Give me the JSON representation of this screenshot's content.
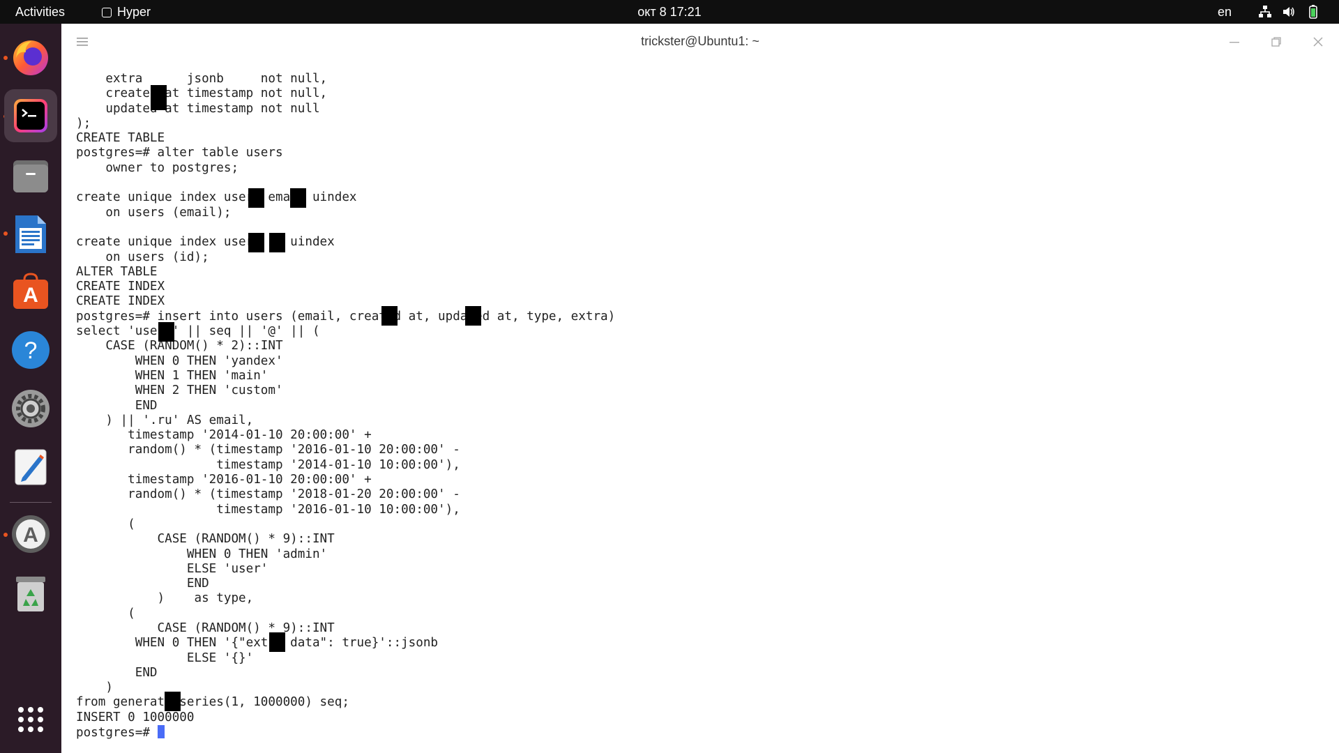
{
  "topbar": {
    "activities": "Activities",
    "app_name": "Hyper",
    "clock": "окт 8  17:21",
    "language": "en"
  },
  "dock": {
    "items": [
      {
        "name": "firefox",
        "icon": "firefox-icon"
      },
      {
        "name": "hyper-terminal",
        "icon": "terminal-icon",
        "active": true
      },
      {
        "name": "files",
        "icon": "files-icon"
      },
      {
        "name": "libreoffice-writer",
        "icon": "writer-icon"
      },
      {
        "name": "ubuntu-software",
        "icon": "software-icon"
      },
      {
        "name": "help",
        "icon": "help-icon"
      },
      {
        "name": "settings",
        "icon": "settings-icon"
      },
      {
        "name": "text-editor",
        "icon": "text-editor-icon"
      },
      {
        "name": "software-updater",
        "icon": "updater-icon"
      },
      {
        "name": "trash",
        "icon": "trash-icon"
      },
      {
        "name": "show-applications",
        "icon": "apps-grid-icon"
      }
    ]
  },
  "window": {
    "title": "trickster@Ubuntu1: ~"
  },
  "terminal": {
    "lines": [
      "    extra      jsonb     not null,",
      "    created at timestamp not null,",
      "    updated at timestamp not null",
      ");",
      "CREATE TABLE",
      "postgres=# alter table users",
      "    owner to postgres;",
      "",
      "create unique index users email uindex",
      "    on users (email);",
      "",
      "create unique index users id uindex",
      "    on users (id);",
      "ALTER TABLE",
      "CREATE INDEX",
      "CREATE INDEX",
      "postgres=# insert into users (email, created at, updated at, type, extra)",
      "select 'user ' || seq || '@' || (",
      "    CASE (RANDOM() * 2)::INT",
      "        WHEN 0 THEN 'yandex'",
      "        WHEN 1 THEN 'main'",
      "        WHEN 2 THEN 'custom'",
      "        END",
      "    ) || '.ru' AS email,",
      "       timestamp '2014-01-10 20:00:00' +",
      "       random() * (timestamp '2016-01-10 20:00:00' -",
      "                   timestamp '2014-01-10 10:00:00'),",
      "       timestamp '2016-01-10 20:00:00' +",
      "       random() * (timestamp '2018-01-20 20:00:00' -",
      "                   timestamp '2016-01-10 10:00:00'),",
      "       (",
      "           CASE (RANDOM() * 9)::INT",
      "               WHEN 0 THEN 'admin'",
      "               ELSE 'user'",
      "               END",
      "           )    as type,",
      "       (",
      "           CASE (RANDOM() * 9)::INT",
      "        WHEN 0 THEN '{\"extra data\": true}'::jsonb",
      "               ELSE '{}'",
      "        END",
      "    )",
      "from generate series(1, 1000000) seq;",
      "INSERT 0 1000000",
      "postgres=# "
    ]
  }
}
